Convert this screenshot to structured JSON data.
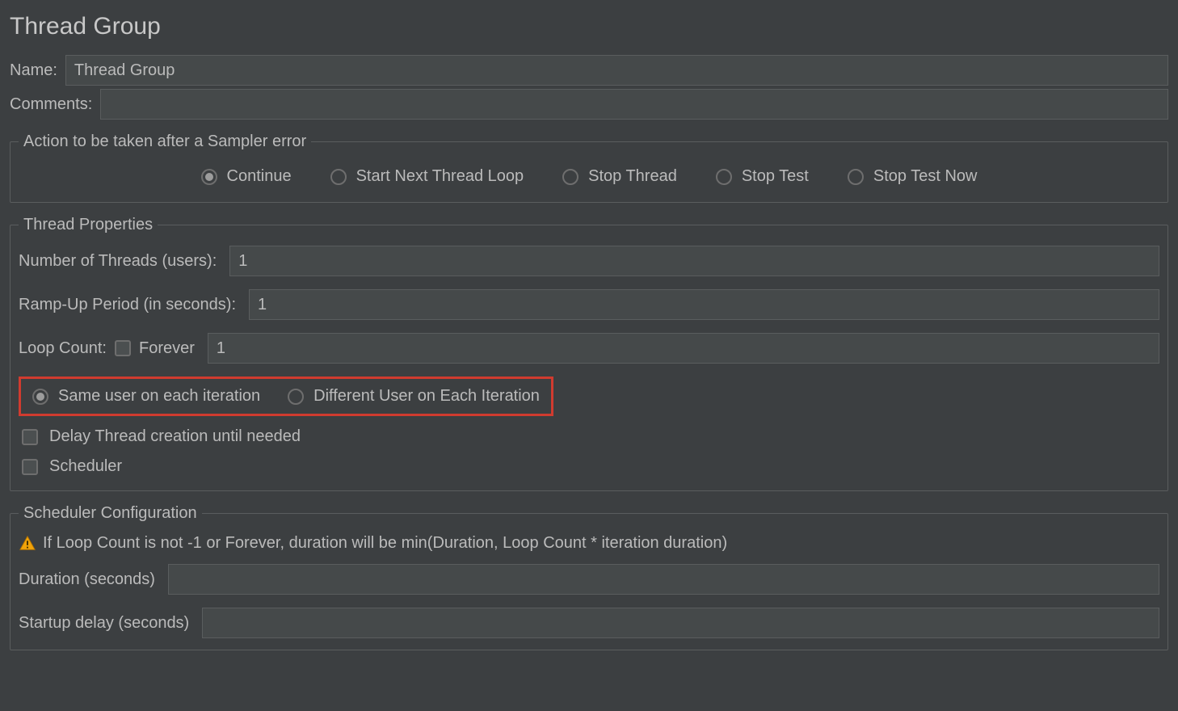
{
  "title": "Thread Group",
  "name_label": "Name:",
  "name_value": "Thread Group",
  "comments_label": "Comments:",
  "comments_value": "",
  "error_action": {
    "legend": "Action to be taken after a Sampler error",
    "options": [
      {
        "label": "Continue",
        "selected": true
      },
      {
        "label": "Start Next Thread Loop",
        "selected": false
      },
      {
        "label": "Stop Thread",
        "selected": false
      },
      {
        "label": "Stop Test",
        "selected": false
      },
      {
        "label": "Stop Test Now",
        "selected": false
      }
    ]
  },
  "thread_props": {
    "legend": "Thread Properties",
    "num_threads_label": "Number of Threads (users):",
    "num_threads_value": "1",
    "ramp_up_label": "Ramp-Up Period (in seconds):",
    "ramp_up_value": "1",
    "loop_count_label": "Loop Count:",
    "forever_label": "Forever",
    "loop_count_value": "1",
    "user_iter": {
      "same_label": "Same user on each iteration",
      "diff_label": "Different User on Each Iteration",
      "same_selected": true
    },
    "delay_label": "Delay Thread creation until needed",
    "scheduler_label": "Scheduler"
  },
  "scheduler_conf": {
    "legend": "Scheduler Configuration",
    "warning": "If Loop Count is not -1 or Forever, duration will be min(Duration, Loop Count * iteration duration)",
    "duration_label": "Duration (seconds)",
    "duration_value": "",
    "startup_delay_label": "Startup delay (seconds)",
    "startup_delay_value": ""
  }
}
